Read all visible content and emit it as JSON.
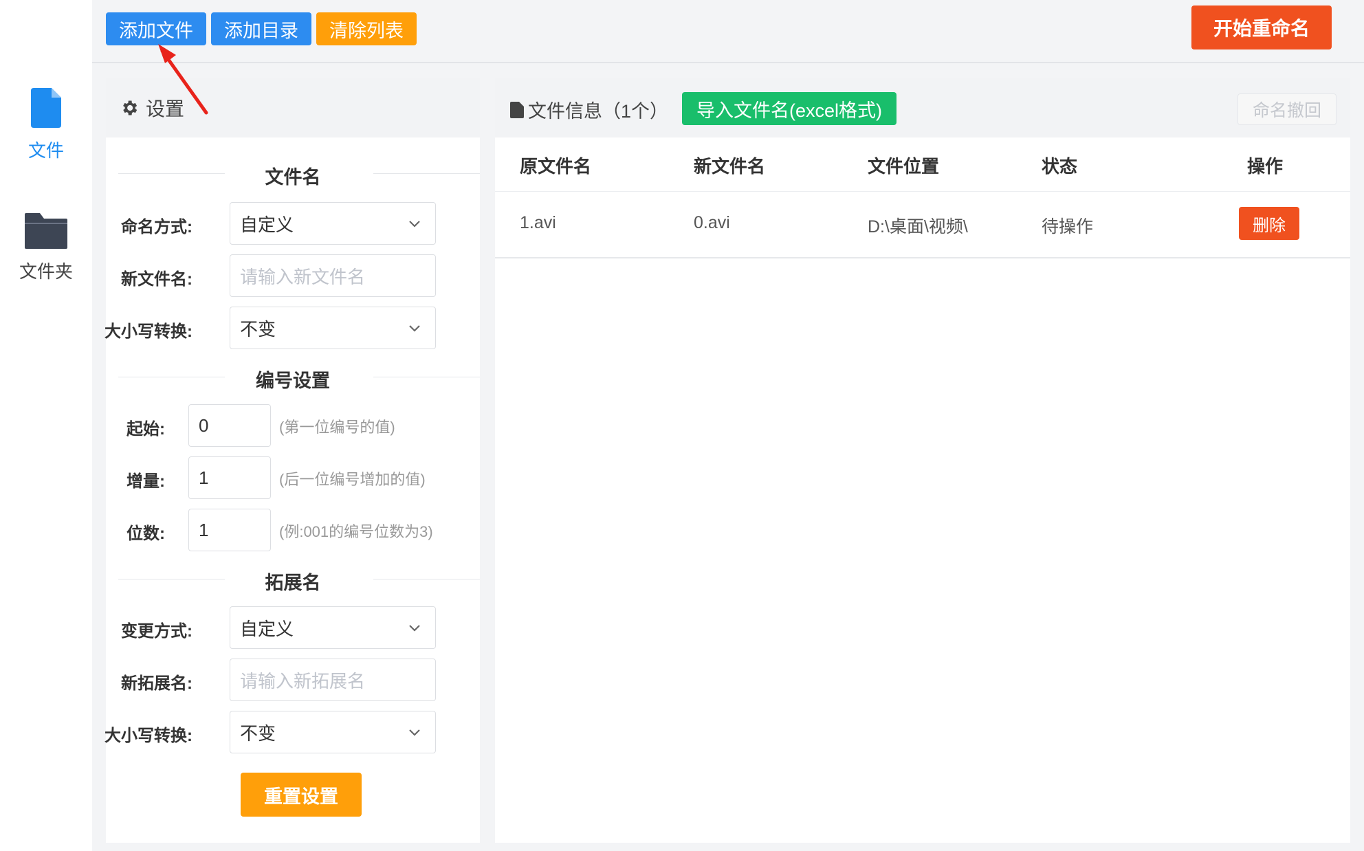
{
  "nav": {
    "items": [
      {
        "label": "文件",
        "icon": "file-icon",
        "active": true
      },
      {
        "label": "文件夹",
        "icon": "folder-icon",
        "active": false
      }
    ]
  },
  "toolbar": {
    "add_file": "添加文件",
    "add_dir": "添加目录",
    "clear_list": "清除列表",
    "start_rename": "开始重命名"
  },
  "settings": {
    "title": "设置",
    "filename_section": "文件名",
    "naming_mode_label": "命名方式:",
    "naming_mode_value": "自定义",
    "new_name_label": "新文件名:",
    "new_name_placeholder": "请输入新文件名",
    "case_label": "大小写转换:",
    "case_value": "不变",
    "numbering_section": "编号设置",
    "start_label": "起始:",
    "start_value": "0",
    "start_hint": "(第一位编号的值)",
    "increment_label": "增量:",
    "increment_value": "1",
    "increment_hint": "(后一位编号增加的值)",
    "digits_label": "位数:",
    "digits_value": "1",
    "digits_hint": "(例:001的编号位数为3)",
    "extension_section": "拓展名",
    "ext_mode_label": "变更方式:",
    "ext_mode_value": "自定义",
    "new_ext_label": "新拓展名:",
    "new_ext_placeholder": "请输入新拓展名",
    "ext_case_label": "大小写转换:",
    "ext_case_value": "不变",
    "reset_button": "重置设置"
  },
  "fileinfo": {
    "title": "文件信息（1个）",
    "import_button": "导入文件名(excel格式)",
    "undo_button": "命名撤回",
    "columns": [
      "原文件名",
      "新文件名",
      "文件位置",
      "状态",
      "操作"
    ],
    "rows": [
      {
        "original": "1.avi",
        "new": "0.avi",
        "location": "D:\\桌面\\视频\\",
        "status": "待操作",
        "action": "删除"
      }
    ]
  },
  "colors": {
    "primary": "#2d8cf0",
    "warning": "#ff9f0a",
    "danger": "#f0511f",
    "success": "#19be6b",
    "annotation_arrow": "#e8231b"
  }
}
